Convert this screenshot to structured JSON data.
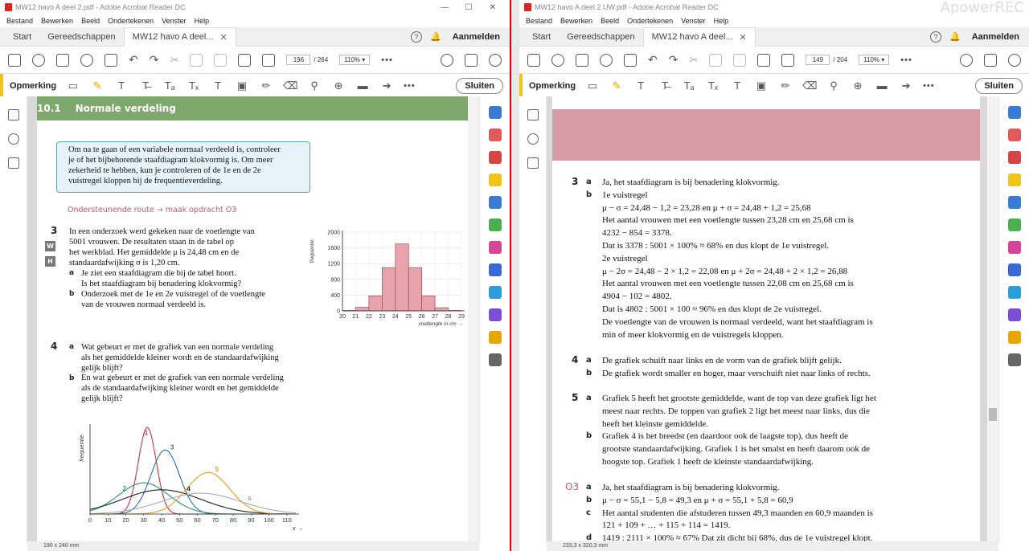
{
  "watermark": "ApowerREC",
  "left": {
    "window_title": "MW12 havo A deel 2.pdf - Adobe Acrobat Reader DC",
    "menu": [
      "Bestand",
      "Bewerken",
      "Beeld",
      "Ondertekenen",
      "Venster",
      "Help"
    ],
    "tabs": [
      "Start",
      "Gereedschappen",
      "MW12 havo A deel..."
    ],
    "help_label": "?",
    "login": "Aanmelden",
    "page_current": "196",
    "page_total": "/ 264",
    "zoom": "110%",
    "comment_label": "Opmerking",
    "close_label": "Sluiten",
    "status": "190 x 240 mm",
    "section_num": "10.1",
    "section_title": "Normale verdeling",
    "infobox": [
      "Om na te gaan of een variabele normaal verdeeld is, controleer",
      "je of het bijbehorende staafdiagram klokvormig is. Om meer",
      "zekerheid te hebben, kun je controleren of de 1e en de 2e",
      "vuistregel kloppen bij de frequentieverdeling."
    ],
    "route": "Ondersteunende route → maak opdracht O3",
    "q3_num": "3",
    "badges": [
      "W",
      "H"
    ],
    "q3_text": [
      "In een onderzoek werd gekeken naar de voetlengte van",
      "5001 vrouwen. De resultaten staan in de tabel op",
      "het werkblad. Het gemiddelde μ is 24,48 cm en de",
      "standaardafwijking σ is 1,20 cm."
    ],
    "q3a_label": "a",
    "q3a": [
      "Je ziet een staafdiagram die bij de tabel hoort.",
      "Is het staafdiagram bij benadering klokvormig?"
    ],
    "q3b_label": "b",
    "q3b": [
      "Onderzoek met de 1e en 2e vuistregel of de voetlengte",
      "van de vrouwen normaal verdeeld is."
    ],
    "q4_num": "4",
    "q4a_label": "a",
    "q4a": [
      "Wat gebeurt er met de grafiek van een normale verdeling",
      "als het gemiddelde kleiner wordt en de standaardafwijking",
      "gelijk blijft?"
    ],
    "q4b_label": "b",
    "q4b": [
      "En wat gebeurt er met de grafiek van een normale verdeling",
      "als de standaardafwijking kleiner wordt en het gemiddelde",
      "gelijk blijft?"
    ]
  },
  "right": {
    "window_title": "MW12 havo A deel 2 UW.pdf - Adobe Acrobat Reader DC",
    "menu": [
      "Bestand",
      "Bewerken",
      "Beeld",
      "Ondertekenen",
      "Venster",
      "Help"
    ],
    "tabs": [
      "Start",
      "Gereedschappen",
      "MW12 havo A deel..."
    ],
    "help_label": "?",
    "login": "Aanmelden",
    "page_current": "149",
    "page_total": "/ 204",
    "zoom": "110%",
    "comment_label": "Opmerking",
    "close_label": "Sluiten",
    "status": "233,3 x 320,3 mm",
    "answers": [
      {
        "num": "3",
        "sub": "a",
        "text": "Ja, het staafdiagram is bij benadering klokvormig."
      },
      {
        "sub": "b",
        "text": "1e vuistregel"
      },
      {
        "text": "μ − σ = 24,48 − 1,2 = 23,28 en μ + σ = 24,48 + 1,2 = 25,68"
      },
      {
        "text": "Het aantal vrouwen met een voetlengte tussen 23,28 cm en 25,68 cm is"
      },
      {
        "text": "4232 − 854 = 3378."
      },
      {
        "text": "Dat is 3378 : 5001 × 100% ≈ 68% en dus klopt de 1e vuistregel."
      },
      {
        "text": "2e vuistregel"
      },
      {
        "text": "μ − 2σ = 24,48 − 2 × 1,2 = 22,08 en μ + 2σ = 24,48 + 2 × 1,2 = 26,88"
      },
      {
        "text": "Het aantal vrouwen met een voetlengte tussen 22,08 cm en 25,68 cm is"
      },
      {
        "text": "4904 − 102 = 4802."
      },
      {
        "text": "Dat is 4802 : 5001 × 100 ≈ 96% en dus klopt de 2e vuistregel."
      },
      {
        "text": "De voetlengte van de vrouwen is normaal verdeeld, want het staafdiagram is"
      },
      {
        "text": "min of meer klokvormig en de vuistregels kloppen."
      }
    ],
    "answers4": [
      {
        "num": "4",
        "sub": "a",
        "text": "De grafiek schuift naar links en de vorm van de grafiek blijft gelijk."
      },
      {
        "sub": "b",
        "text": "De grafiek wordt smaller en hoger, maar verschuift niet naar links of rechts."
      }
    ],
    "answers5": [
      {
        "num": "5",
        "sub": "a",
        "text": "Grafiek 5 heeft het grootste gemiddelde, want de top van deze grafiek ligt het"
      },
      {
        "text": "meest naar rechts. De toppen van grafiek 2 ligt het meest naar links, dus die"
      },
      {
        "text": "heeft het kleinste gemiddelde."
      },
      {
        "sub": "b",
        "text": "Grafiek 4 is het breedst (en daardoor ook de laagste top), dus heeft de"
      },
      {
        "text": "grootste standaardafwijking. Grafiek 1 is het smalst en heeft daarom ook de"
      },
      {
        "text": "hoogste top. Grafiek 1 heeft de kleinste standaardafwijking."
      }
    ],
    "answersO3": [
      {
        "num": "O3",
        "sub": "a",
        "text": "Ja, het staafdiagram is bij benadering klokvormig."
      },
      {
        "sub": "b",
        "text": "μ − σ = 55,1 − 5,8 = 49,3 en μ + σ = 55,1 + 5,8 = 60,9"
      },
      {
        "sub": "c",
        "text": "Het aantal studenten die afstuderen tussen 49,3 maanden en 60,9 maanden is"
      },
      {
        "text": "121 + 109 + … + 115 + 114 = 1419."
      },
      {
        "sub": "d",
        "text": "1419 : 2111 × 100% ≈ 67% Dat zit dicht bij 68%, dus de 1e vuistregel klopt."
      }
    ]
  },
  "chart_data": [
    {
      "type": "bar",
      "xlabel": "voetlengte in cm",
      "ylabel": "frequentie",
      "x_ticks": [
        "20",
        "21",
        "22",
        "23",
        "24",
        "25",
        "26",
        "27",
        "28",
        "29"
      ],
      "y_ticks": [
        "0",
        "400",
        "800",
        "1200",
        "1600",
        "2000"
      ],
      "categories": [
        "20-21",
        "21-22",
        "22-23",
        "23-24",
        "24-25",
        "25-26",
        "26-27",
        "27-28",
        "28-29"
      ],
      "values": [
        10,
        90,
        380,
        1100,
        1700,
        1100,
        380,
        80,
        10
      ],
      "ylim": [
        0,
        2000
      ],
      "color": "#e8a3ad"
    },
    {
      "type": "line",
      "xlabel": "x",
      "ylabel": "frequentie",
      "x_ticks": [
        "0",
        "10",
        "20",
        "30",
        "40",
        "50",
        "60",
        "70",
        "80",
        "90",
        "100",
        "110"
      ],
      "xlim": [
        0,
        115
      ],
      "series": [
        {
          "name": "1",
          "mean": 32,
          "sd": 5,
          "peak": 1.0,
          "color": "#c8344a"
        },
        {
          "name": "2",
          "mean": 30,
          "sd": 14,
          "peak": 0.36,
          "color": "#2a8f84"
        },
        {
          "name": "3",
          "mean": 42,
          "sd": 8,
          "peak": 0.74,
          "color": "#2b6fb2"
        },
        {
          "name": "4",
          "mean": 40,
          "sd": 22,
          "peak": 0.28,
          "color": "#222222"
        },
        {
          "name": "5",
          "mean": 66,
          "sd": 12,
          "peak": 0.48,
          "color": "#e2a21e"
        },
        {
          "name": "6",
          "mean": 62,
          "sd": 22,
          "peak": 0.24,
          "color": "#aaaaaa"
        }
      ]
    }
  ]
}
